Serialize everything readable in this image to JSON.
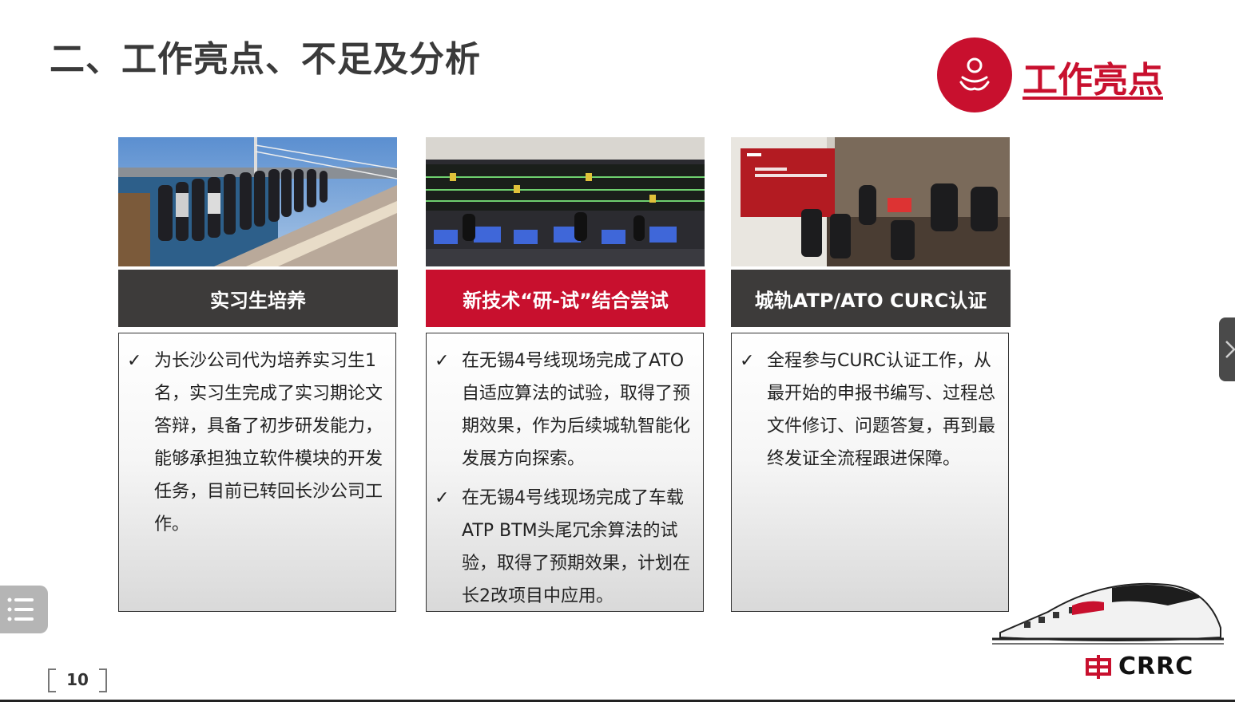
{
  "slide": {
    "title": "二、工作亮点、不足及分析",
    "badge_label": "工作亮点",
    "page_number": "10",
    "logo_text": "CRRC"
  },
  "colors": {
    "accent_red": "#c8102e",
    "dark_header": "#3d3b3a"
  },
  "cards": [
    {
      "header": "实习生培养",
      "photo": "group-photo-on-bridge",
      "bullets": [
        "为长沙公司代为培养实习生1名，实习生完成了实习期论文答辩，具备了初步研发能力，能够承担独立软件模块的开发任务，目前已转回长沙公司工作。"
      ]
    },
    {
      "header": "新技术“研-试”结合尝试",
      "photo": "control-center-photo",
      "bullets": [
        "在无锡4号线现场完成了ATO自适应算法的试验，取得了预期效果，作为后续城轨智能化发展方向探索。",
        "在无锡4号线现场完成了车载ATP BTM头尾冗余算法的试验，取得了预期效果，计划在长2改项目中应用。"
      ]
    },
    {
      "header": "城轨ATP/ATO CURC认证",
      "photo": "meeting-room-photo",
      "bullets": [
        "全程参与CURC认证工作，从最开始的申报书编写、过程总文件修订、问题答复，再到最终发证全流程跟进保障。"
      ]
    }
  ],
  "check_glyph": "✓"
}
